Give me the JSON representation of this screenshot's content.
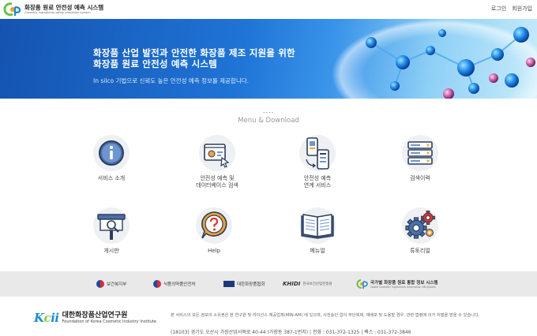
{
  "header": {
    "logo_title": "화장품 원료 안전성 예측 시스템",
    "logo_subtitle": "Cosmetic ingredients safety prediction system",
    "login": "로그인",
    "signup": "회원가입"
  },
  "hero": {
    "line1": "화장품 산업 발전과 안전한 화장품 제조 지원을 위한",
    "line2": "화장품 원료 안전성 예측 시스템",
    "description": "In silco 기법으로 신뢰도 높은 안전성 예측 정보를 제공합니다."
  },
  "menu": {
    "dots": "....",
    "title": "Menu & Download",
    "items": [
      {
        "label": "서비스 소개",
        "icon": "info-icon"
      },
      {
        "label": "안전성 예측 및\n데이터베이스 검색",
        "icon": "database-search-icon"
      },
      {
        "label": "안전성 예측\n연계 서비스",
        "icon": "linked-devices-icon"
      },
      {
        "label": "검색이력",
        "icon": "server-list-icon"
      },
      {
        "label": "게시판",
        "icon": "board-icon"
      },
      {
        "label": "Help",
        "icon": "help-icon"
      },
      {
        "label": "메뉴얼",
        "icon": "book-icon"
      },
      {
        "label": "튜토리얼",
        "icon": "gears-icon"
      }
    ]
  },
  "partners": [
    {
      "name": "보건복지부"
    },
    {
      "name": "식품의약품안전처"
    },
    {
      "name": "대한화장품협회"
    },
    {
      "name": "한국보건산업진흥원",
      "logo": "KHIDI"
    },
    {
      "name": "국가별 화장품 원료 통합 정보 시스템",
      "sub": "Global Cosmetic Ingredients Information DB System"
    }
  ],
  "footer": {
    "logo_kor": "대한화장품산업연구원",
    "logo_eng": "Foundation of Korea Cosmetic Industry Institute",
    "notice": "본 서비스의 모든 정보의 소유권은 본 연구원 및 라이선스 제공업체(MIN-AM) 에 있으며, 사전승인 없이 무단복제, 재배포 및 도용할 경우, 관련 법령에 의거 처벌을 받을 수 있습니다.",
    "address": "(18103) 경기도 오산시 가장산업서북로 40-44 (가장동 387-1번지)  |  전화 : 031-372-1325  |  팩스 : 031-372-3846"
  }
}
